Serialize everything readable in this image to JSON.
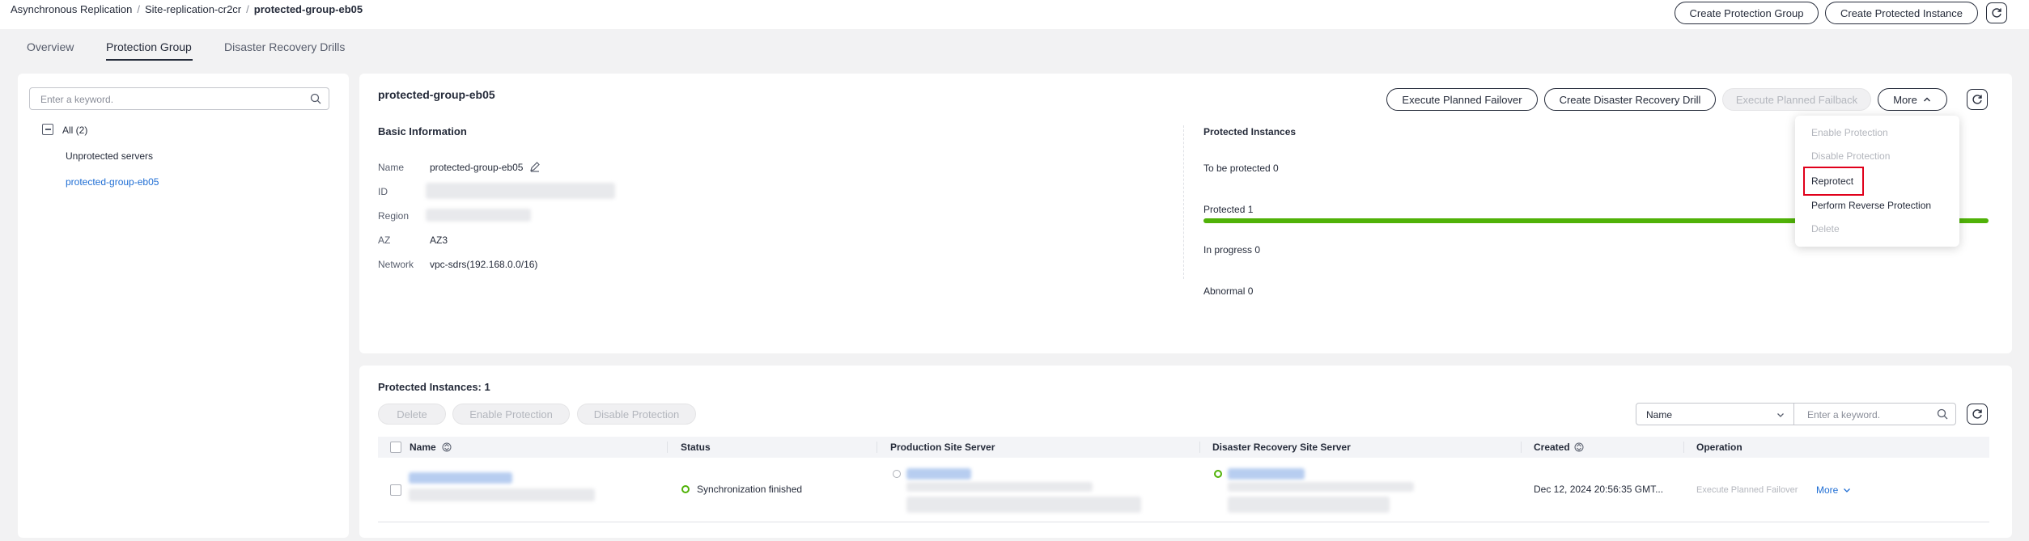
{
  "breadcrumb": {
    "items": [
      "Asynchronous Replication",
      "Site-replication-cr2cr",
      "protected-group-eb05"
    ],
    "separator": "/"
  },
  "header_actions": {
    "create_protection_group": "Create Protection Group",
    "create_protected_instance": "Create Protected Instance"
  },
  "tabs": [
    {
      "label": "Overview",
      "active": false
    },
    {
      "label": "Protection Group",
      "active": true
    },
    {
      "label": "Disaster Recovery Drills",
      "active": false
    }
  ],
  "sidebar": {
    "search_placeholder": "Enter a keyword.",
    "tree": {
      "root_label": "All (2)",
      "items": [
        {
          "label": "Unprotected servers",
          "selected": false
        },
        {
          "label": "protected-group-eb05",
          "selected": true
        }
      ]
    }
  },
  "detail": {
    "title": "protected-group-eb05",
    "actions": {
      "planned_failover": "Execute Planned Failover",
      "create_drill": "Create Disaster Recovery Drill",
      "planned_failback": "Execute Planned Failback",
      "more": "More"
    },
    "basic_info": {
      "heading": "Basic Information",
      "fields": [
        {
          "label": "Name",
          "value": "protected-group-eb05",
          "redacted": false
        },
        {
          "label": "ID",
          "value": "",
          "redacted": true
        },
        {
          "label": "Region",
          "value": "",
          "redacted": true
        },
        {
          "label": "AZ",
          "value": "AZ3",
          "redacted": false
        },
        {
          "label": "Network",
          "value": "vpc-sdrs(192.168.0.0/16)",
          "redacted": false
        }
      ]
    },
    "protected_instances": {
      "heading": "Protected Instances",
      "to_be_protected": "To be protected 0",
      "protected": "Protected 1",
      "protected_fraction": 1.0,
      "in_progress": "In progress 0",
      "abnormal": "Abnormal 0"
    },
    "more_menu": [
      {
        "label": "Enable Protection",
        "enabled": false
      },
      {
        "label": "Disable Protection",
        "enabled": false
      },
      {
        "label": "Reprotect",
        "enabled": true,
        "highlighted": true
      },
      {
        "label": "Perform Reverse Protection",
        "enabled": true
      },
      {
        "label": "Delete",
        "enabled": false
      }
    ]
  },
  "instances": {
    "title": "Protected Instances: 1",
    "batch_actions": {
      "delete": "Delete",
      "enable": "Enable Protection",
      "disable": "Disable Protection"
    },
    "filter": {
      "select_value": "Name",
      "search_placeholder": "Enter a keyword."
    },
    "columns": [
      "Name",
      "Status",
      "Production Site Server",
      "Disaster Recovery Site Server",
      "Created",
      "Operation"
    ],
    "rows": [
      {
        "status": "Synchronization finished",
        "created": "Dec 12, 2024 20:56:35 GMT...",
        "op_failover": "Execute Planned Failover",
        "op_more": "More"
      }
    ]
  },
  "colors": {
    "link": "#1f6ed4",
    "success": "#50b208",
    "highlight": "#e0001b",
    "text": "#252b3a"
  }
}
